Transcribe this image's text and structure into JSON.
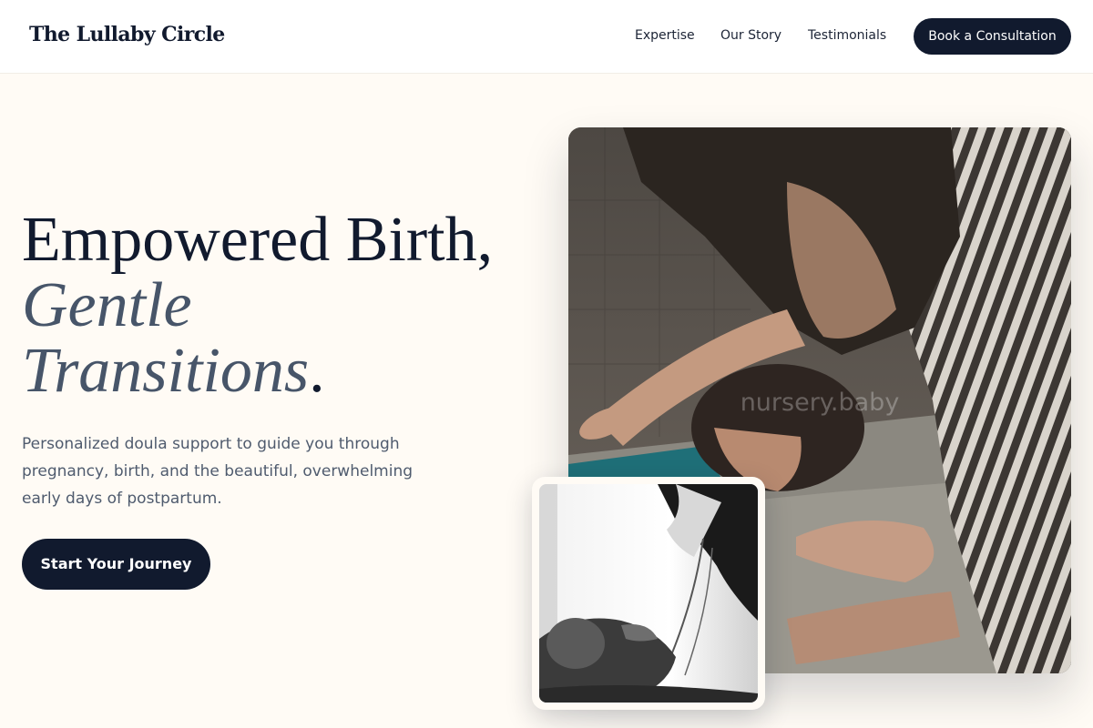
{
  "header": {
    "logo": "The Lullaby Circle",
    "nav": [
      {
        "label": "Expertise"
      },
      {
        "label": "Our Story"
      },
      {
        "label": "Testimonials"
      }
    ],
    "cta_label": "Book a Consultation"
  },
  "hero": {
    "headline_line1": "Empowered Birth,",
    "headline_line2": "Gentle",
    "headline_line3": "Transitions",
    "headline_period": ".",
    "subtext": "Personalized doula support to guide you through pregnancy, birth, and the beautiful, overwhelming early days of postpartum.",
    "cta_label": "Start Your Journey"
  },
  "images": {
    "main_caption": "nursery.baby"
  },
  "colors": {
    "navy": "#111a2e",
    "slate_accent": "#475569",
    "background": "#fffbf5"
  }
}
